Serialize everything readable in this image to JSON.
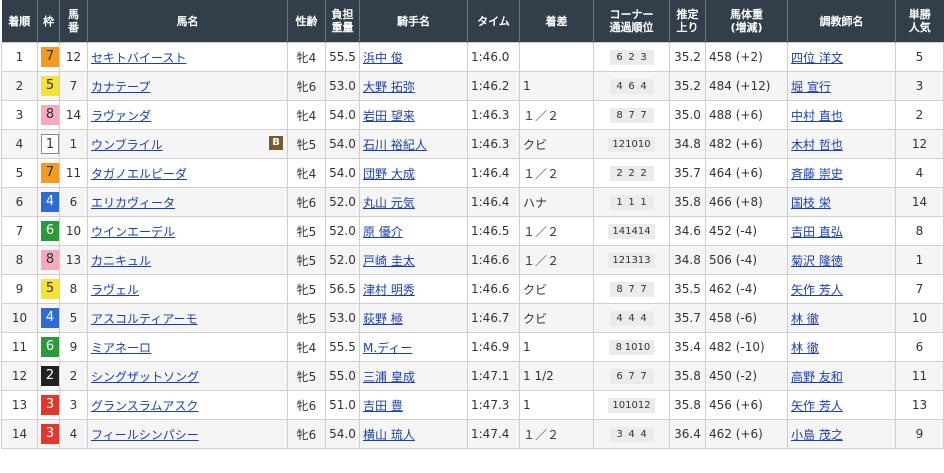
{
  "headers": [
    "着順",
    "枠",
    "馬番",
    "馬名",
    "性齢",
    "負担重量",
    "騎手名",
    "タイム",
    "着差",
    "コーナー通過順位",
    "推定上り",
    "馬体重(増減)",
    "調教師名",
    "単勝人気"
  ],
  "headers_lines": [
    [
      "着順"
    ],
    [
      "枠"
    ],
    [
      "馬",
      "番"
    ],
    [
      "馬名"
    ],
    [
      "性齢"
    ],
    [
      "負担",
      "重量"
    ],
    [
      "騎手名"
    ],
    [
      "タイム"
    ],
    [
      "着差"
    ],
    [
      "コーナー",
      "通過順位"
    ],
    [
      "推定",
      "上り"
    ],
    [
      "馬体重",
      "(増減)"
    ],
    [
      "調教師名"
    ],
    [
      "単勝",
      "人気"
    ]
  ],
  "rows": [
    {
      "rank": "1",
      "waku": "7",
      "umaban": "12",
      "horse": "セキトバイースト",
      "blink": "",
      "sexage": "牝4",
      "weight": "55.5",
      "jockey": "浜中 俊",
      "time": "1:46.0",
      "margin": "",
      "corners": [
        "6",
        "2",
        "3"
      ],
      "last3f": "35.2",
      "bodyweight": "458 (+2)",
      "trainer": "四位 洋文",
      "pop": "5"
    },
    {
      "rank": "2",
      "waku": "5",
      "umaban": "7",
      "horse": "カナテープ",
      "blink": "",
      "sexage": "牝6",
      "weight": "53.0",
      "jockey": "大野 拓弥",
      "time": "1:46.2",
      "margin": "1",
      "corners": [
        "4",
        "6",
        "4"
      ],
      "last3f": "35.2",
      "bodyweight": "484 (+12)",
      "trainer": "堀 宣行",
      "pop": "3"
    },
    {
      "rank": "3",
      "waku": "8",
      "umaban": "14",
      "horse": "ラヴァンダ",
      "blink": "",
      "sexage": "牝4",
      "weight": "54.0",
      "jockey": "岩田 望来",
      "time": "1:46.3",
      "margin": "１／２",
      "corners": [
        "8",
        "7",
        "7"
      ],
      "last3f": "35.0",
      "bodyweight": "488 (+6)",
      "trainer": "中村 直也",
      "pop": "2"
    },
    {
      "rank": "4",
      "waku": "1",
      "umaban": "1",
      "horse": "ウンブライル",
      "blink": "B",
      "sexage": "牝5",
      "weight": "54.0",
      "jockey": "石川 裕紀人",
      "time": "1:46.3",
      "margin": "クビ",
      "corners": [
        "12",
        "10",
        "10"
      ],
      "last3f": "34.8",
      "bodyweight": "482 (+6)",
      "trainer": "木村 哲也",
      "pop": "12"
    },
    {
      "rank": "5",
      "waku": "7",
      "umaban": "11",
      "horse": "タガノエルピーダ",
      "blink": "",
      "sexage": "牝4",
      "weight": "54.0",
      "jockey": "団野 大成",
      "time": "1:46.4",
      "margin": "１／２",
      "corners": [
        "2",
        "2",
        "2"
      ],
      "last3f": "35.7",
      "bodyweight": "464 (+6)",
      "trainer": "斉藤 崇史",
      "pop": "4"
    },
    {
      "rank": "6",
      "waku": "4",
      "umaban": "6",
      "horse": "エリカヴィータ",
      "blink": "",
      "sexage": "牝6",
      "weight": "52.0",
      "jockey": "丸山 元気",
      "time": "1:46.4",
      "margin": "ハナ",
      "corners": [
        "1",
        "1",
        "1"
      ],
      "last3f": "35.8",
      "bodyweight": "466 (+8)",
      "trainer": "国枝 栄",
      "pop": "14"
    },
    {
      "rank": "7",
      "waku": "6",
      "umaban": "10",
      "horse": "ウインエーデル",
      "blink": "",
      "sexage": "牝5",
      "weight": "52.0",
      "jockey": "原 優介",
      "time": "1:46.5",
      "margin": "１／２",
      "corners": [
        "14",
        "14",
        "14"
      ],
      "last3f": "34.6",
      "bodyweight": "452 (-4)",
      "trainer": "吉田 直弘",
      "pop": "8"
    },
    {
      "rank": "8",
      "waku": "8",
      "umaban": "13",
      "horse": "カニキュル",
      "blink": "",
      "sexage": "牝5",
      "weight": "52.0",
      "jockey": "戸崎 圭太",
      "time": "1:46.6",
      "margin": "１／２",
      "corners": [
        "12",
        "13",
        "13"
      ],
      "last3f": "34.8",
      "bodyweight": "506 (-4)",
      "trainer": "菊沢 隆徳",
      "pop": "1"
    },
    {
      "rank": "9",
      "waku": "5",
      "umaban": "8",
      "horse": "ラヴェル",
      "blink": "",
      "sexage": "牝5",
      "weight": "56.5",
      "jockey": "津村 明秀",
      "time": "1:46.6",
      "margin": "クビ",
      "corners": [
        "8",
        "7",
        "7"
      ],
      "last3f": "35.5",
      "bodyweight": "462 (-4)",
      "trainer": "矢作 芳人",
      "pop": "7"
    },
    {
      "rank": "10",
      "waku": "4",
      "umaban": "5",
      "horse": "アスコルティアーモ",
      "blink": "",
      "sexage": "牝5",
      "weight": "53.0",
      "jockey": "荻野 極",
      "time": "1:46.7",
      "margin": "クビ",
      "corners": [
        "4",
        "4",
        "4"
      ],
      "last3f": "35.7",
      "bodyweight": "458 (-6)",
      "trainer": "林 徹",
      "pop": "10"
    },
    {
      "rank": "11",
      "waku": "6",
      "umaban": "9",
      "horse": "ミアネーロ",
      "blink": "",
      "sexage": "牝4",
      "weight": "55.5",
      "jockey": "M.ディー",
      "time": "1:46.9",
      "margin": "1",
      "corners": [
        "8",
        "10",
        "10"
      ],
      "last3f": "35.4",
      "bodyweight": "482 (-10)",
      "trainer": "林 徹",
      "pop": "6"
    },
    {
      "rank": "12",
      "waku": "2",
      "umaban": "2",
      "horse": "シングザットソング",
      "blink": "",
      "sexage": "牝5",
      "weight": "55.0",
      "jockey": "三浦 皇成",
      "time": "1:47.1",
      "margin": "1 1/2",
      "corners": [
        "6",
        "7",
        "7"
      ],
      "last3f": "35.8",
      "bodyweight": "450 (-2)",
      "trainer": "高野 友和",
      "pop": "11"
    },
    {
      "rank": "13",
      "waku": "3",
      "umaban": "3",
      "horse": "グランスラムアスク",
      "blink": "",
      "sexage": "牝6",
      "weight": "51.0",
      "jockey": "吉田 豊",
      "time": "1:47.3",
      "margin": "1",
      "corners": [
        "10",
        "10",
        "12"
      ],
      "last3f": "35.8",
      "bodyweight": "456 (+6)",
      "trainer": "矢作 芳人",
      "pop": "13"
    },
    {
      "rank": "14",
      "waku": "3",
      "umaban": "4",
      "horse": "フィールシンパシー",
      "blink": "",
      "sexage": "牝6",
      "weight": "54.0",
      "jockey": "横山 琉人",
      "time": "1:47.4",
      "margin": "１／２",
      "corners": [
        "3",
        "4",
        "4"
      ],
      "last3f": "36.4",
      "bodyweight": "462 (+6)",
      "trainer": "小島 茂之",
      "pop": "9"
    }
  ],
  "waku_colors": {
    "1": "#ffffff",
    "2": "#222222",
    "3": "#e3362d",
    "4": "#2f6bd1",
    "5": "#f4e13a",
    "6": "#2a9a3a",
    "7": "#f39a22",
    "8": "#f5aabd"
  },
  "link_color": "#1a3fb5",
  "header_bg": "#323f4b"
}
